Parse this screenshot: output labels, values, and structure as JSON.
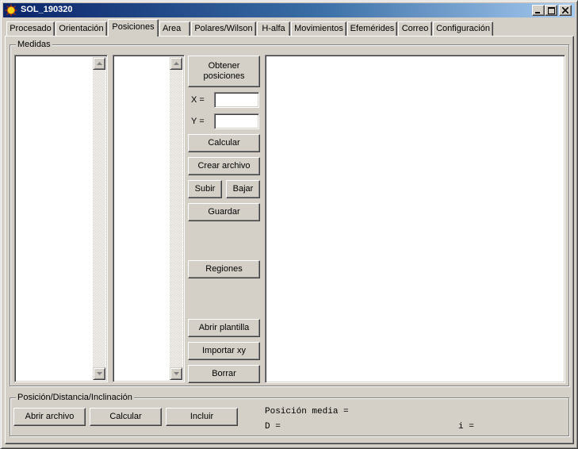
{
  "window": {
    "title": "SOL_190320",
    "colors": {
      "titlebar_start": "#0a246a",
      "titlebar_end": "#a6caf0",
      "face": "#d4d0c8"
    }
  },
  "caption_buttons": [
    "minimize-icon",
    "maximize-icon",
    "close-icon"
  ],
  "tabs": [
    {
      "label": "Procesado"
    },
    {
      "label": "Orientación"
    },
    {
      "label": "Posiciones",
      "active": true
    },
    {
      "label": "Area"
    },
    {
      "label": "Polares/Wilson"
    },
    {
      "label": "H-alfa"
    },
    {
      "label": "Movimientos"
    },
    {
      "label": "Efemérides"
    },
    {
      "label": "Correo"
    },
    {
      "label": "Configuración"
    }
  ],
  "medidas": {
    "legend": "Medidas",
    "obtener_label": "Obtener posiciones",
    "x_label": "X =",
    "x_value": "",
    "y_label": "Y =",
    "y_value": "",
    "calcular_label": "Calcular",
    "crear_archivo_label": "Crear archivo",
    "subir_label": "Subir",
    "bajar_label": "Bajar",
    "guardar_label": "Guardar",
    "regiones_label": "Regiones",
    "abrir_plantilla_label": "Abrir plantilla",
    "importar_xy_label": "Importar xy",
    "borrar_label": "Borrar"
  },
  "pdi": {
    "legend": "Posición/Distancia/Inclinación",
    "abrir_archivo_label": "Abrir archivo",
    "calcular_label": "Calcular",
    "incluir_label": "Incluir",
    "posicion_media_label": "Posición media =",
    "d_label": "D =",
    "i_label": "i ="
  }
}
